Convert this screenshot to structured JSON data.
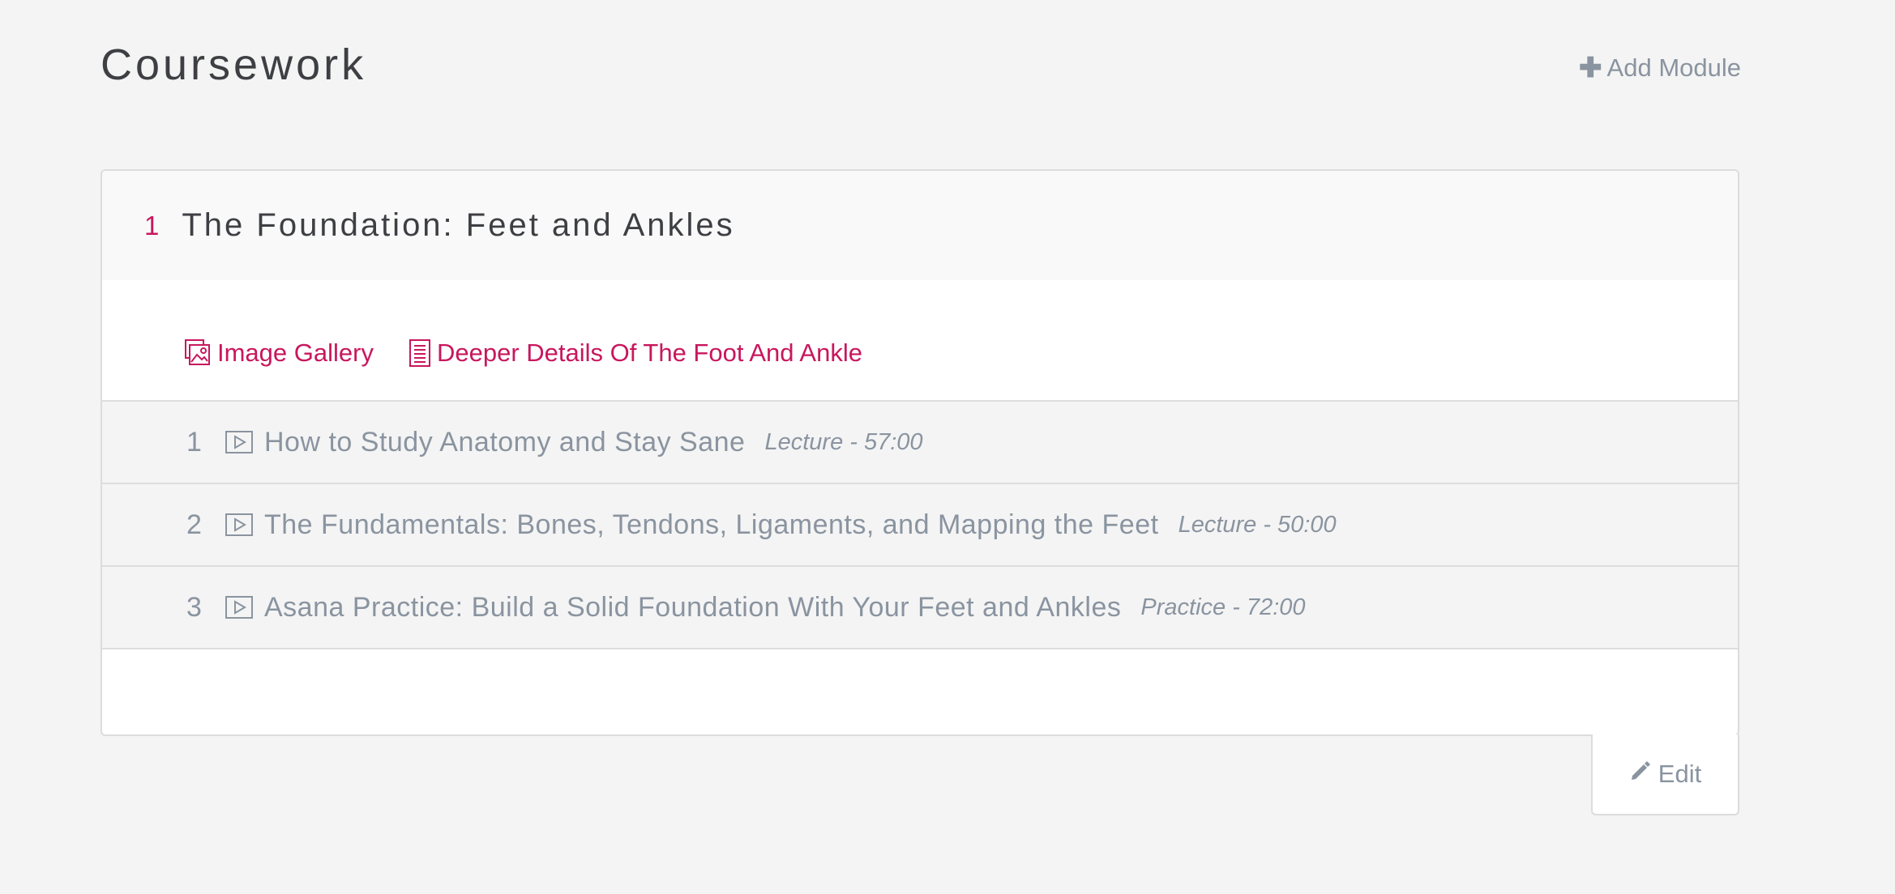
{
  "page": {
    "title": "Coursework",
    "add_module_label": "Add Module",
    "edit_label": "Edit"
  },
  "module": {
    "number": "1",
    "title": "The Foundation: Feet and Ankles",
    "resources": [
      {
        "label": "Image Gallery",
        "icon": "image-gallery-icon"
      },
      {
        "label": "Deeper Details Of The Foot And Ankle",
        "icon": "document-icon"
      }
    ],
    "lessons": [
      {
        "number": "1",
        "title": "How to Study Anatomy and Stay Sane",
        "meta": "Lecture - 57:00",
        "icon": "video-icon"
      },
      {
        "number": "2",
        "title": "The Fundamentals: Bones, Tendons, Ligaments, and Mapping the Feet",
        "meta": "Lecture - 50:00",
        "icon": "video-icon"
      },
      {
        "number": "3",
        "title": "Asana Practice: Build a Solid Foundation With Your Feet and Ankles",
        "meta": "Practice - 72:00",
        "icon": "video-icon"
      }
    ]
  },
  "colors": {
    "accent": "#c8175d",
    "muted_text": "#8a94a0",
    "background": "#f4f4f4"
  }
}
